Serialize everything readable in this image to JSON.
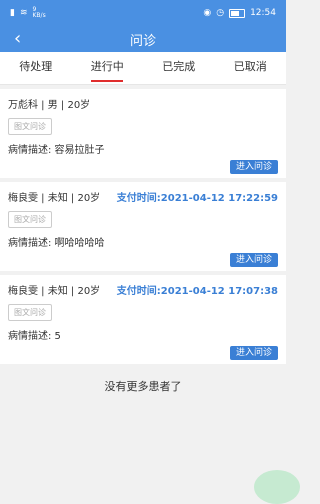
{
  "status_bar": {
    "left_icons": [
      "sim-icon",
      "wifi-icon"
    ],
    "net_speed": "9\nKB/s",
    "right_icons": [
      "eye-icon",
      "alarm-icon",
      "battery-icon"
    ],
    "time": "12:54"
  },
  "nav": {
    "title": "问诊",
    "back_icon": "‹"
  },
  "tabs": [
    {
      "label": "待处理",
      "active": false
    },
    {
      "label": "进行中",
      "active": true
    },
    {
      "label": "已完成",
      "active": false
    },
    {
      "label": "已取消",
      "active": false
    }
  ],
  "cards": [
    {
      "patient": "万彪科 | 男 | 20岁",
      "pay_time": "",
      "tag": "图文问诊",
      "desc": "病情描述: 容易拉肚子",
      "button": "进入问诊"
    },
    {
      "patient": "梅良雯 | 未知 | 20岁",
      "pay_time": "支付时间:2021-04-12 17:22:59",
      "tag": "图文问诊",
      "desc": "病情描述: 啊哈哈哈哈",
      "button": "进入问诊"
    },
    {
      "patient": "梅良雯 | 未知 | 20岁",
      "pay_time": "支付时间:2021-04-12 17:07:38",
      "tag": "图文问诊",
      "desc": "病情描述: 5",
      "button": "进入问诊"
    }
  ],
  "no_more": "没有更多患者了",
  "colors": {
    "primary": "#4a90e2",
    "accent": "#3a7fd5",
    "tab_indicator": "#e02d2d",
    "fab": "#c6ead1"
  }
}
